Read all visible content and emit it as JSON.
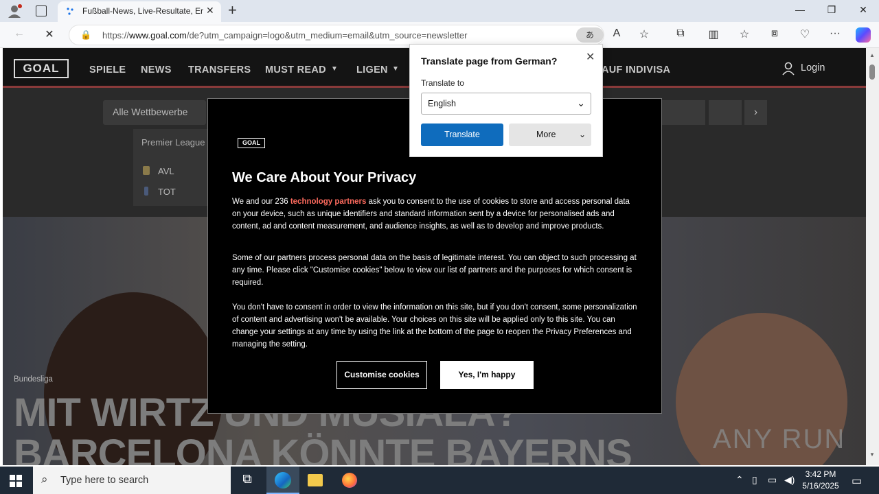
{
  "browser": {
    "tab_title": "Fußball-News, Live-Resultate, Erg",
    "new_tab": "+",
    "url_prefix": "https://",
    "url_domain": "www.goal.com",
    "url_rest": "/de?utm_campaign=logo&utm_medium=email&utm_source=newsletter"
  },
  "site": {
    "logo": "GOAL",
    "nav": [
      "SPIELE",
      "NEWS",
      "TRANSFERS",
      "MUST READ",
      "LIGEN",
      "AUF INDIVISA"
    ],
    "login": "Login",
    "competition": "Alle Wettbewerbe",
    "league_title": "Premier League",
    "teams": [
      "AVL",
      "TOT"
    ],
    "category": "Bundesliga",
    "headline_1": "MIT WIRTZ UND MUSIALA?",
    "headline_2": "BARCELONA KÖNNTE BAYERNS",
    "watermark": "ANY RUN"
  },
  "privacy": {
    "logo": "GOAL",
    "title": "We Care About Your Privacy",
    "p1_a": "We and our 236 ",
    "p1_link": "technology partners",
    "p1_b": " ask you to consent to the use of cookies to store and access personal data on your device, such as unique identifiers and standard information sent by a device for personalised ads and content, ad and content measurement, and audience insights, as well as to develop and improve products.",
    "p2": "Some of our partners process personal data on the basis of legitimate interest. You can object to such processing at any time. Please click \"Customise cookies\" below to view our list of partners and the purposes for which consent is required.",
    "p3": "You don't have to consent in order to view the information on this site, but if you don't consent, some personalization of content and advertising won't be available. Your choices on this site will be applied only to this site. You can change your settings at any time by using the link at the bottom of the page to reopen the Privacy Preferences and managing the setting.",
    "btn_customise": "Customise cookies",
    "btn_happy": "Yes, I'm happy"
  },
  "translate": {
    "title": "Translate page from German?",
    "label": "Translate to",
    "selected": "English",
    "btn_translate": "Translate",
    "btn_more": "More"
  },
  "taskbar": {
    "search_placeholder": "Type here to search",
    "time": "3:42 PM",
    "date": "5/16/2025"
  }
}
